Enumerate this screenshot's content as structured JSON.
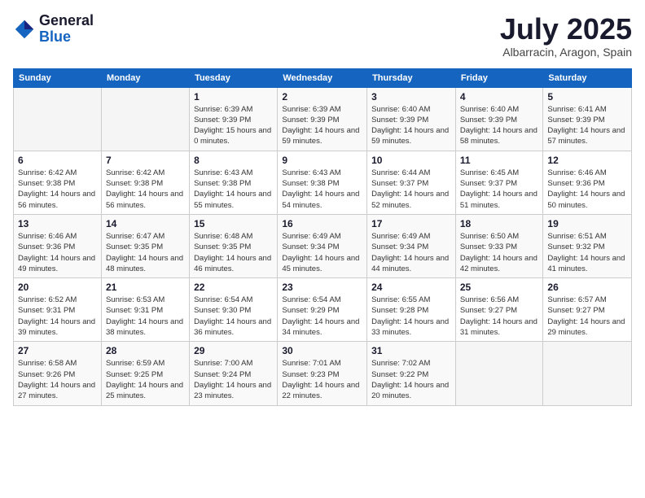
{
  "logo": {
    "general": "General",
    "blue": "Blue"
  },
  "title": "July 2025",
  "location": "Albarracin, Aragon, Spain",
  "days_of_week": [
    "Sunday",
    "Monday",
    "Tuesday",
    "Wednesday",
    "Thursday",
    "Friday",
    "Saturday"
  ],
  "weeks": [
    [
      {
        "day": "",
        "info": ""
      },
      {
        "day": "",
        "info": ""
      },
      {
        "day": "1",
        "info": "Sunrise: 6:39 AM\nSunset: 9:39 PM\nDaylight: 15 hours and 0 minutes."
      },
      {
        "day": "2",
        "info": "Sunrise: 6:39 AM\nSunset: 9:39 PM\nDaylight: 14 hours and 59 minutes."
      },
      {
        "day": "3",
        "info": "Sunrise: 6:40 AM\nSunset: 9:39 PM\nDaylight: 14 hours and 59 minutes."
      },
      {
        "day": "4",
        "info": "Sunrise: 6:40 AM\nSunset: 9:39 PM\nDaylight: 14 hours and 58 minutes."
      },
      {
        "day": "5",
        "info": "Sunrise: 6:41 AM\nSunset: 9:39 PM\nDaylight: 14 hours and 57 minutes."
      }
    ],
    [
      {
        "day": "6",
        "info": "Sunrise: 6:42 AM\nSunset: 9:38 PM\nDaylight: 14 hours and 56 minutes."
      },
      {
        "day": "7",
        "info": "Sunrise: 6:42 AM\nSunset: 9:38 PM\nDaylight: 14 hours and 56 minutes."
      },
      {
        "day": "8",
        "info": "Sunrise: 6:43 AM\nSunset: 9:38 PM\nDaylight: 14 hours and 55 minutes."
      },
      {
        "day": "9",
        "info": "Sunrise: 6:43 AM\nSunset: 9:38 PM\nDaylight: 14 hours and 54 minutes."
      },
      {
        "day": "10",
        "info": "Sunrise: 6:44 AM\nSunset: 9:37 PM\nDaylight: 14 hours and 52 minutes."
      },
      {
        "day": "11",
        "info": "Sunrise: 6:45 AM\nSunset: 9:37 PM\nDaylight: 14 hours and 51 minutes."
      },
      {
        "day": "12",
        "info": "Sunrise: 6:46 AM\nSunset: 9:36 PM\nDaylight: 14 hours and 50 minutes."
      }
    ],
    [
      {
        "day": "13",
        "info": "Sunrise: 6:46 AM\nSunset: 9:36 PM\nDaylight: 14 hours and 49 minutes."
      },
      {
        "day": "14",
        "info": "Sunrise: 6:47 AM\nSunset: 9:35 PM\nDaylight: 14 hours and 48 minutes."
      },
      {
        "day": "15",
        "info": "Sunrise: 6:48 AM\nSunset: 9:35 PM\nDaylight: 14 hours and 46 minutes."
      },
      {
        "day": "16",
        "info": "Sunrise: 6:49 AM\nSunset: 9:34 PM\nDaylight: 14 hours and 45 minutes."
      },
      {
        "day": "17",
        "info": "Sunrise: 6:49 AM\nSunset: 9:34 PM\nDaylight: 14 hours and 44 minutes."
      },
      {
        "day": "18",
        "info": "Sunrise: 6:50 AM\nSunset: 9:33 PM\nDaylight: 14 hours and 42 minutes."
      },
      {
        "day": "19",
        "info": "Sunrise: 6:51 AM\nSunset: 9:32 PM\nDaylight: 14 hours and 41 minutes."
      }
    ],
    [
      {
        "day": "20",
        "info": "Sunrise: 6:52 AM\nSunset: 9:31 PM\nDaylight: 14 hours and 39 minutes."
      },
      {
        "day": "21",
        "info": "Sunrise: 6:53 AM\nSunset: 9:31 PM\nDaylight: 14 hours and 38 minutes."
      },
      {
        "day": "22",
        "info": "Sunrise: 6:54 AM\nSunset: 9:30 PM\nDaylight: 14 hours and 36 minutes."
      },
      {
        "day": "23",
        "info": "Sunrise: 6:54 AM\nSunset: 9:29 PM\nDaylight: 14 hours and 34 minutes."
      },
      {
        "day": "24",
        "info": "Sunrise: 6:55 AM\nSunset: 9:28 PM\nDaylight: 14 hours and 33 minutes."
      },
      {
        "day": "25",
        "info": "Sunrise: 6:56 AM\nSunset: 9:27 PM\nDaylight: 14 hours and 31 minutes."
      },
      {
        "day": "26",
        "info": "Sunrise: 6:57 AM\nSunset: 9:27 PM\nDaylight: 14 hours and 29 minutes."
      }
    ],
    [
      {
        "day": "27",
        "info": "Sunrise: 6:58 AM\nSunset: 9:26 PM\nDaylight: 14 hours and 27 minutes."
      },
      {
        "day": "28",
        "info": "Sunrise: 6:59 AM\nSunset: 9:25 PM\nDaylight: 14 hours and 25 minutes."
      },
      {
        "day": "29",
        "info": "Sunrise: 7:00 AM\nSunset: 9:24 PM\nDaylight: 14 hours and 23 minutes."
      },
      {
        "day": "30",
        "info": "Sunrise: 7:01 AM\nSunset: 9:23 PM\nDaylight: 14 hours and 22 minutes."
      },
      {
        "day": "31",
        "info": "Sunrise: 7:02 AM\nSunset: 9:22 PM\nDaylight: 14 hours and 20 minutes."
      },
      {
        "day": "",
        "info": ""
      },
      {
        "day": "",
        "info": ""
      }
    ]
  ]
}
